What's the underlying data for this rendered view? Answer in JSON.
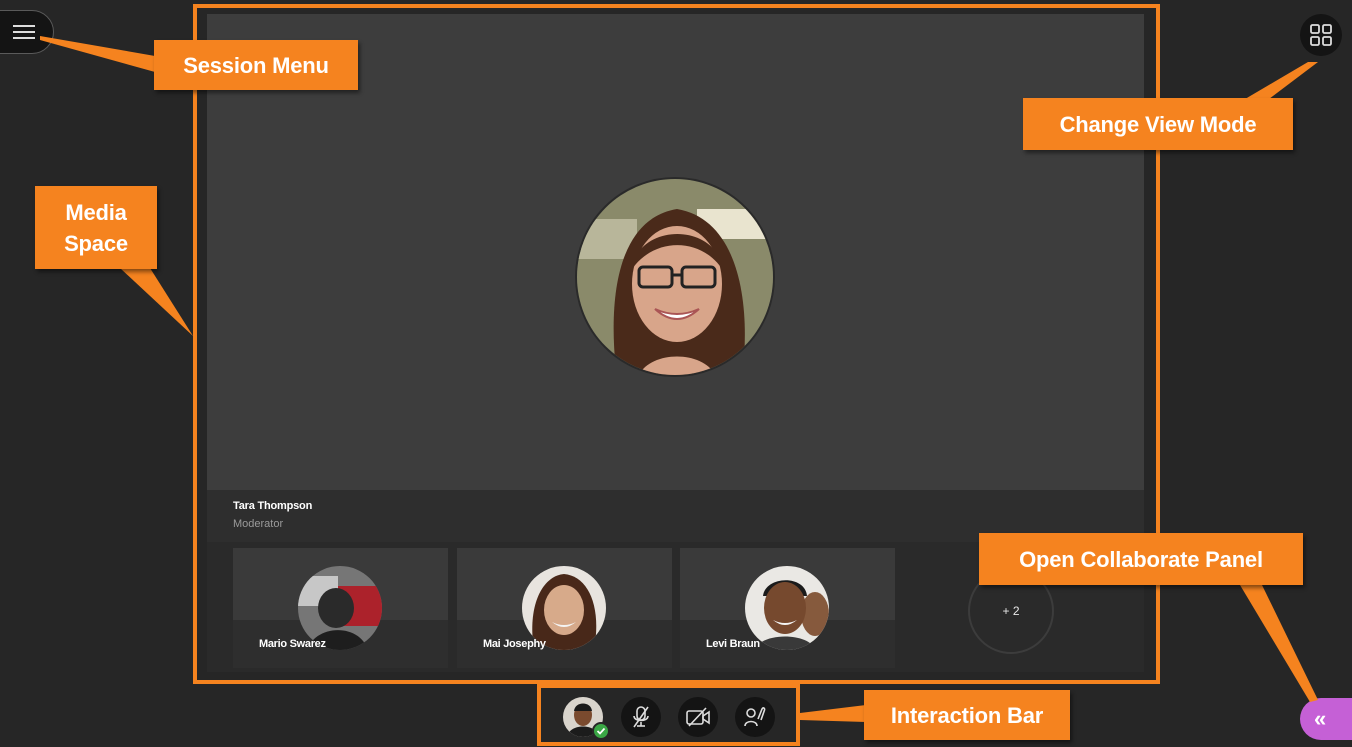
{
  "header": {
    "menu_icon": "hamburger-menu-icon",
    "view_mode_icon": "grid-view-icon"
  },
  "speaker": {
    "name": "Tara Thompson",
    "role": "Moderator"
  },
  "participants": [
    {
      "name": "Mario Swarez"
    },
    {
      "name": "Mai Josephy"
    },
    {
      "name": "Levi Braun"
    }
  ],
  "overflow_count": "+ 2",
  "interaction_bar": {
    "icons": [
      "my-status-avatar",
      "microphone-off-icon",
      "camera-off-icon",
      "raise-hand-icon"
    ]
  },
  "collaborate_tab": {
    "glyph": "«"
  },
  "annotations": {
    "session_menu": "Session Menu",
    "change_view_mode": "Change View Mode",
    "media_space_line1": "Media",
    "media_space_line2": "Space",
    "open_collaborate_panel": "Open Collaborate Panel",
    "interaction_bar": "Interaction Bar"
  },
  "colors": {
    "annotation_orange": "#f5831f",
    "collaborate_purple": "#c560d6",
    "status_green": "#3aa745"
  }
}
